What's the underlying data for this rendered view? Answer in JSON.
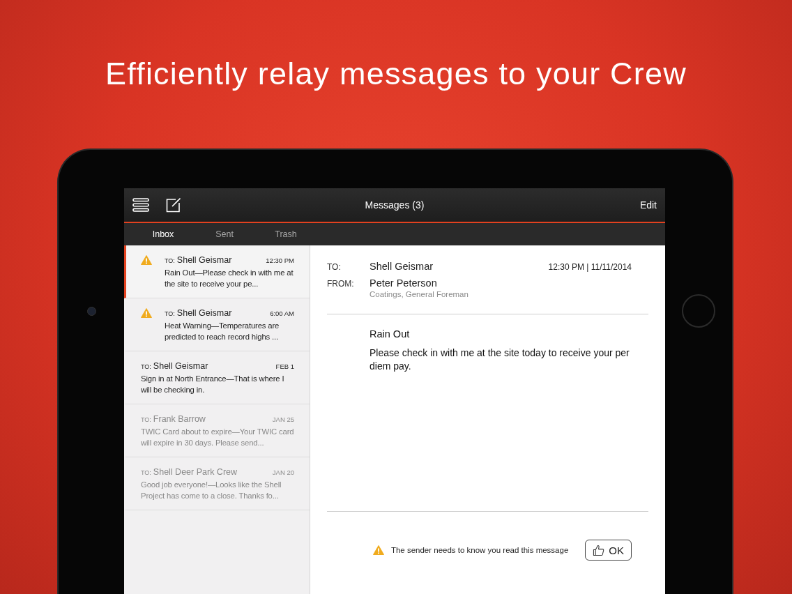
{
  "headline": "Efficiently relay messages to your Crew",
  "toolbar": {
    "title": "Messages (3)",
    "edit": "Edit"
  },
  "tabs": [
    {
      "label": "Inbox",
      "selected": true
    },
    {
      "label": "Sent",
      "selected": false
    },
    {
      "label": "Trash",
      "selected": false
    }
  ],
  "messages": [
    {
      "to_label": "TO:",
      "recipient": "Shell Geismar",
      "time": "12:30 PM",
      "preview": "Rain Out—Please check in with me at the site to receive your pe...",
      "urgent": true,
      "read": false,
      "selected": true
    },
    {
      "to_label": "TO:",
      "recipient": "Shell Geismar",
      "time": "6:00 AM",
      "preview": "Heat Warning—Temperatures are predicted to reach record highs ...",
      "urgent": true,
      "read": false,
      "selected": false
    },
    {
      "to_label": "TO:",
      "recipient": "Shell Geismar",
      "time": "FEB 1",
      "preview": "Sign in at North Entrance—That is where I will be checking in.",
      "urgent": false,
      "read": false,
      "selected": false
    },
    {
      "to_label": "TO:",
      "recipient": "Frank Barrow",
      "time": "JAN 25",
      "preview": "TWIC Card about to expire—Your TWIC card will expire in 30 days. Please send...",
      "urgent": false,
      "read": true,
      "selected": false
    },
    {
      "to_label": "TO:",
      "recipient": "Shell Deer Park Crew",
      "time": "JAN 20",
      "preview": "Good job everyone!—Looks like the Shell Project has come to a close. Thanks fo...",
      "urgent": false,
      "read": true,
      "selected": false
    }
  ],
  "detail": {
    "to_label": "TO:",
    "to": "Shell Geismar",
    "timestamp": "12:30 PM | 11/11/2014",
    "from_label": "FROM:",
    "from": "Peter Peterson",
    "from_role": "Coatings, General Foreman",
    "subject": "Rain Out",
    "body": "Please check in with me at the site today to receive your per diem pay.",
    "notice": "The sender needs to know you read this message",
    "ok": "OK"
  }
}
